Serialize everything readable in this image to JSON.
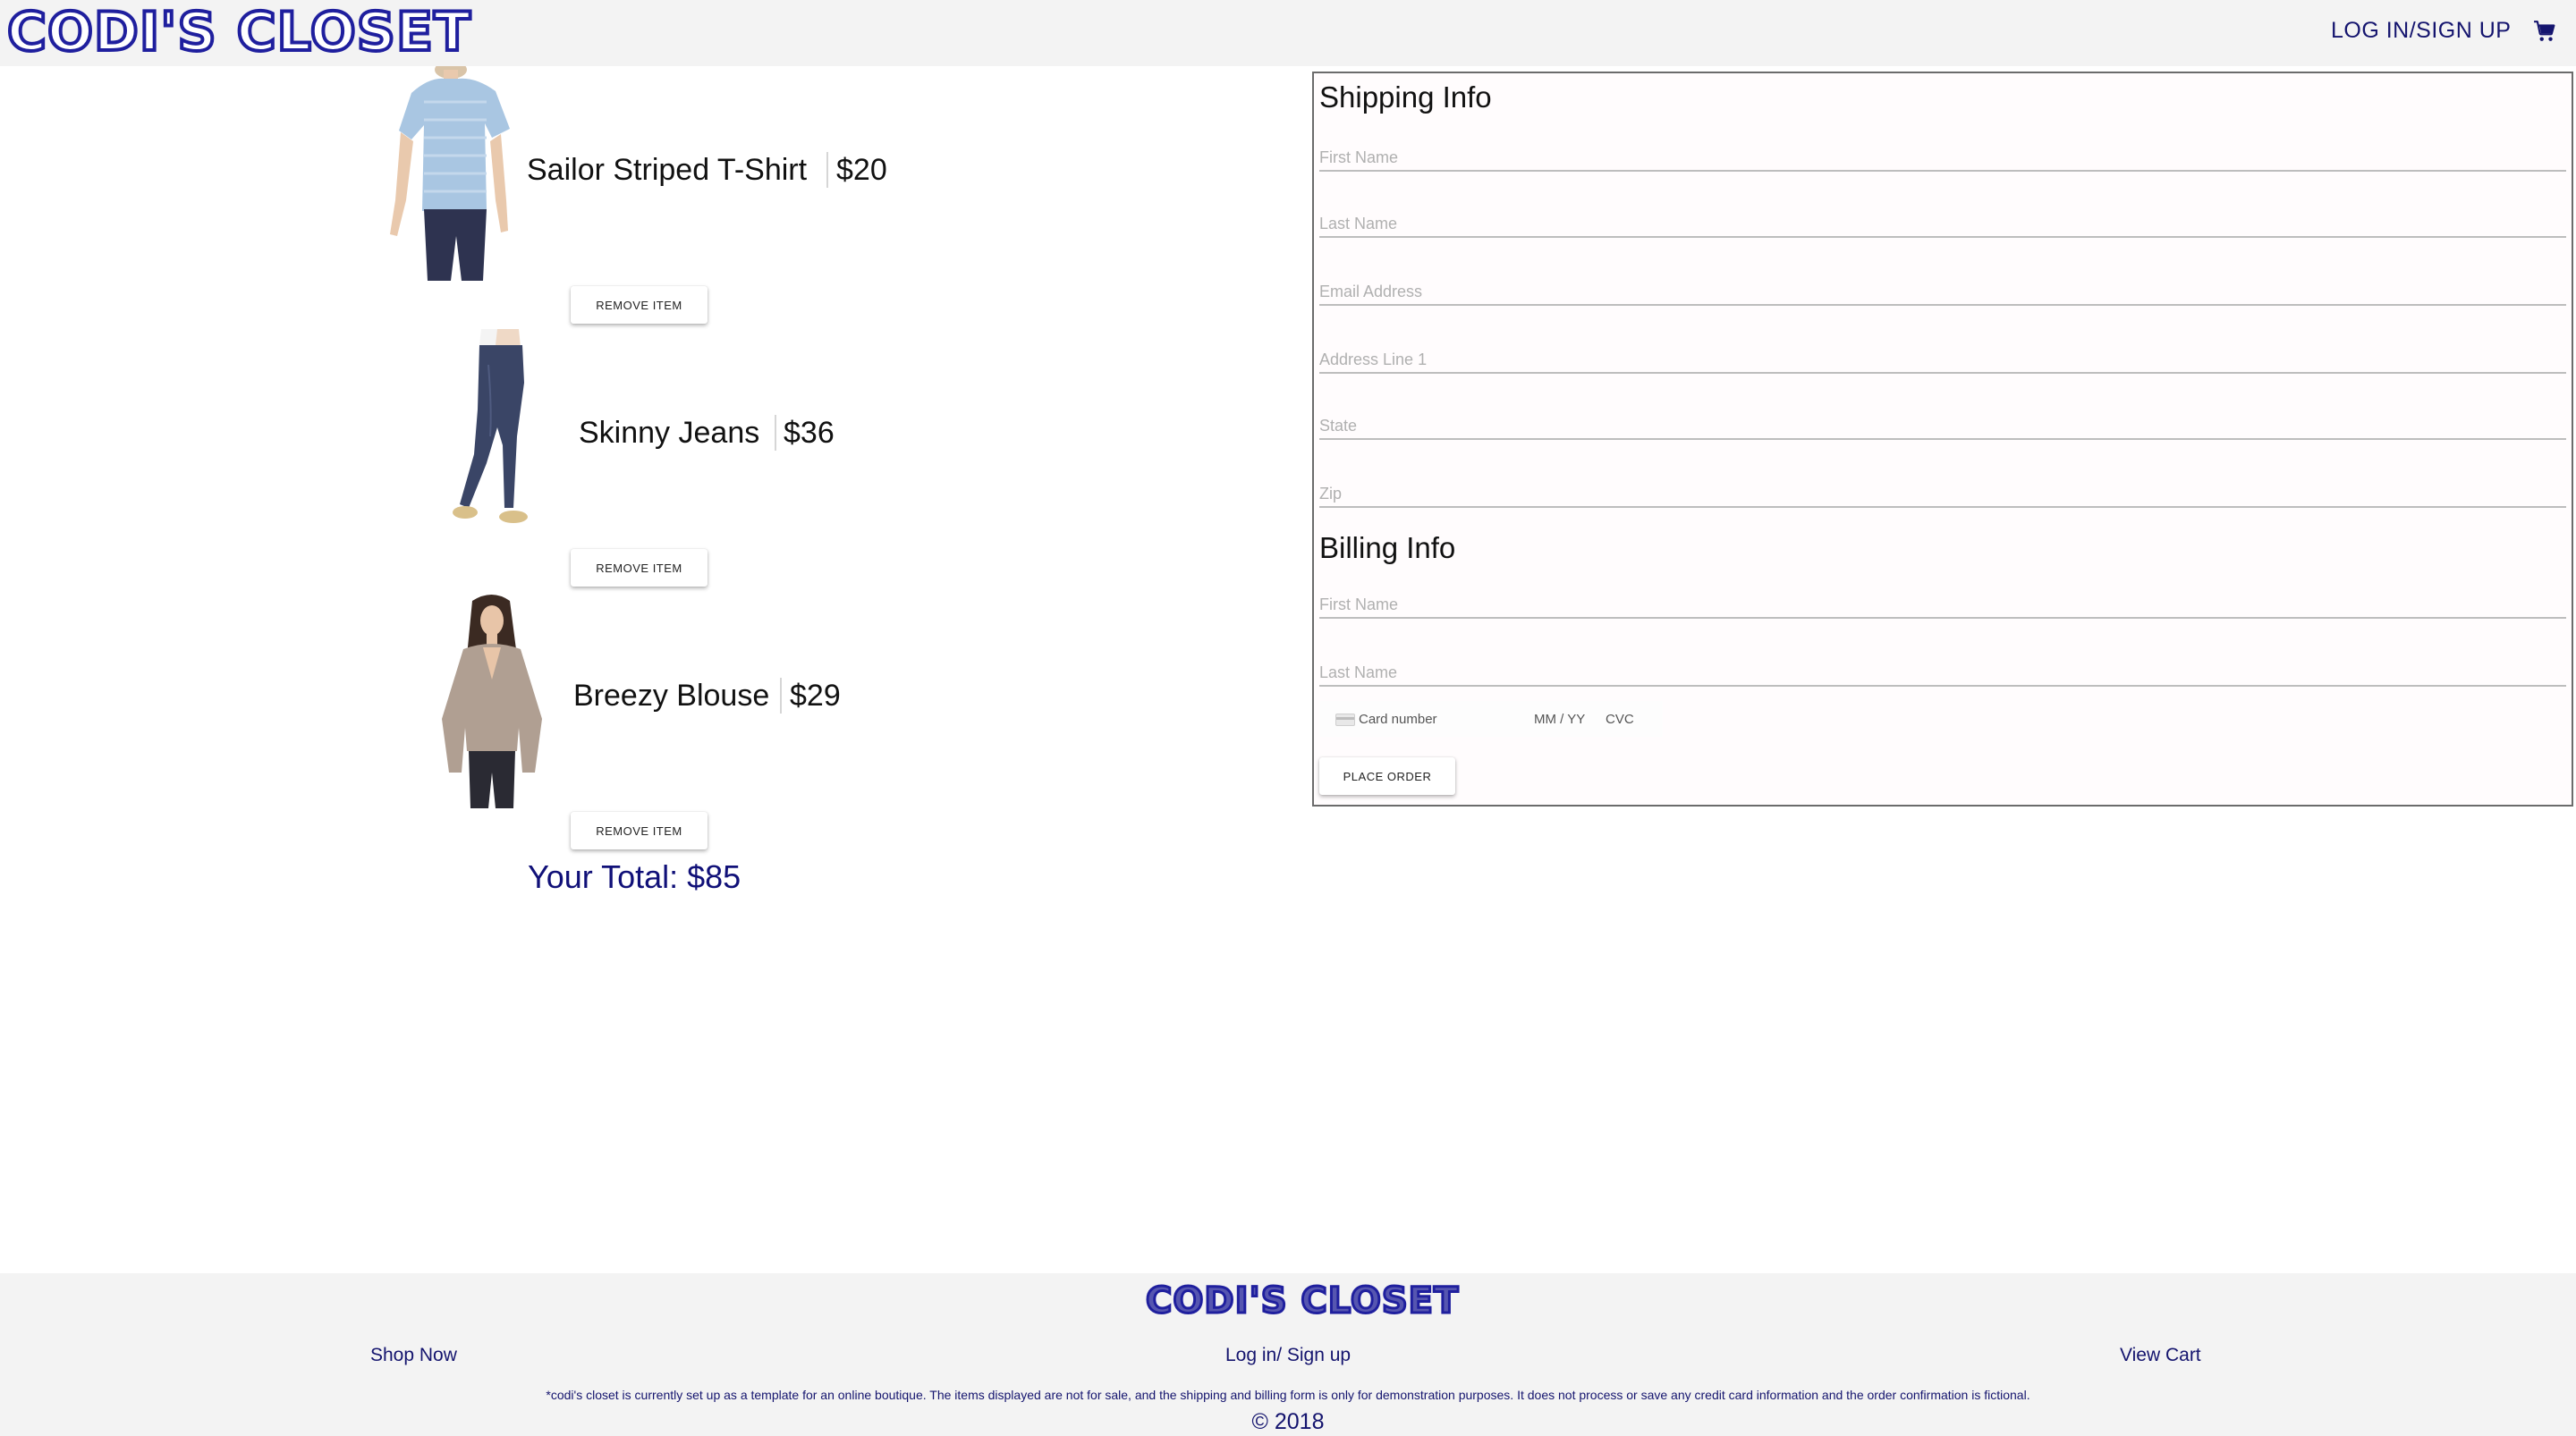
{
  "header": {
    "logo_text": "CODI'S CLOSET",
    "login_label": "LOG IN/SIGN UP",
    "cart_icon": "shopping-cart-icon",
    "accent_color": "#1f1f9e"
  },
  "cart": {
    "items": [
      {
        "name": "Sailor Striped T-Shirt",
        "price": "$20",
        "remove_label": "REMOVE ITEM"
      },
      {
        "name": "Skinny Jeans",
        "price": "$36",
        "remove_label": "REMOVE ITEM"
      },
      {
        "name": "Breezy Blouse",
        "price": "$29",
        "remove_label": "REMOVE ITEM"
      }
    ],
    "total": "Your Total: $85"
  },
  "checkout": {
    "shipping_heading": "Shipping Info",
    "shipping_fields": {
      "first_name": "First Name",
      "last_name": "Last Name",
      "email": "Email Address",
      "address1": "Address Line 1",
      "state": "State",
      "zip": "Zip"
    },
    "billing_heading": "Billing Info",
    "billing_fields": {
      "first_name": "First Name",
      "last_name": "Last Name"
    },
    "card": {
      "number_placeholder": "Card number",
      "exp_placeholder": "MM / YY",
      "cvc_placeholder": "CVC"
    },
    "place_order_label": "PLACE ORDER"
  },
  "footer": {
    "logo_text": "CODI'S CLOSET",
    "links": {
      "shop": "Shop Now",
      "login": "Log in/ Sign up",
      "cart": "View Cart"
    },
    "note": "*codi's closet is currently set up as a template for an online boutique. The items displayed are not for sale, and the shipping and billing form is only for demonstration purposes. It does not process or save any credit card information and the order confirmation is fictional.",
    "copyright": "© 2018"
  }
}
